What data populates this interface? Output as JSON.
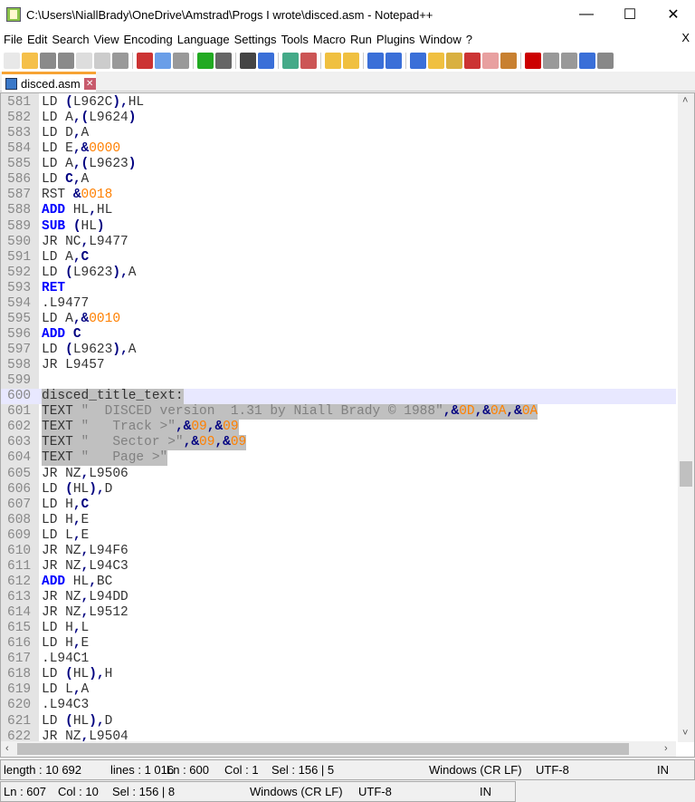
{
  "window": {
    "title": "C:\\Users\\NiallBrady\\OneDrive\\Amstrad\\Progs I wrote\\disced.asm - Notepad++",
    "minimize": "—",
    "maximize": "☐",
    "close": "✕"
  },
  "menu": [
    "File",
    "Edit",
    "Search",
    "View",
    "Encoding",
    "Language",
    "Settings",
    "Tools",
    "Macro",
    "Run",
    "Plugins",
    "Window",
    "?"
  ],
  "menu_close": "X",
  "toolbar_icons": [
    "new",
    "open",
    "save",
    "save-all",
    "close",
    "close-all",
    "print",
    "cut",
    "copy",
    "paste",
    "undo",
    "redo",
    "find",
    "replace",
    "zoom-in",
    "zoom-out",
    "sync-vertical",
    "sync-horizontal",
    "word-wrap",
    "show-all-chars",
    "indent-guide",
    "udl",
    "doc-map",
    "function-list",
    "folder-workspace",
    "monitor",
    "record-macro",
    "stop-macro",
    "play-macro",
    "run-macro-multiple",
    "save-macro"
  ],
  "tab": {
    "label": "disced.asm",
    "close": "✕"
  },
  "editor": {
    "first_line": 581,
    "current_line": 600,
    "selected_lines": [
      600,
      601,
      602,
      603,
      604
    ],
    "lines": [
      "LD (L962C),HL",
      "LD A,(L9624)",
      "LD D,A",
      "LD E,&0000",
      "LD A,(L9623)",
      "LD C,A",
      "RST &0018",
      "ADD HL,HL",
      "SUB (HL)",
      "JR NC,L9477",
      "LD A,C",
      "LD (L9623),A",
      "RET",
      ".L9477",
      "LD A,&0010",
      "ADD C",
      "LD (L9623),A",
      "JR L9457",
      "",
      "disced_title_text:",
      "TEXT \"  DISCED version  1.31 by Niall Brady © 1988\",&0D,&0A,&0A",
      "TEXT \"   Track >\",&09,&09",
      "TEXT \"   Sector >\",&09,&09",
      "TEXT \"   Page >\"",
      "JR NZ,L9506",
      "LD (HL),D",
      "LD H,C",
      "LD H,E",
      "LD L,E",
      "JR NZ,L94F6",
      "JR NZ,L94C3",
      "ADD HL,BC",
      "JR NZ,L94DD",
      "JR NZ,L9512",
      "LD H,L",
      "LD H,E",
      ".L94C1",
      "LD (HL),H",
      "LD L,A",
      ".L94C3",
      "LD (HL),D",
      "JR NZ,L9504"
    ]
  },
  "status1": {
    "length": "length : 10 692",
    "lines": "lines : 1 016",
    "ln": "Ln : 600",
    "col": "Col : 1",
    "sel": "Sel : 156 | 5",
    "eol": "Windows (CR LF)",
    "encoding": "UTF-8",
    "mode": "IN"
  },
  "status2": {
    "ln": "Ln : 607",
    "col": "Col : 10",
    "sel": "Sel : 156 | 8",
    "eol": "Windows (CR LF)",
    "encoding": "UTF-8",
    "mode": "IN"
  },
  "colors": {
    "keyword": "#0000ff",
    "operator": "#000080",
    "number": "#ff8000",
    "string": "#808080",
    "selection": "#c0c0c0",
    "current_line": "#e8e8ff",
    "tab_accent": "#f7a334"
  }
}
